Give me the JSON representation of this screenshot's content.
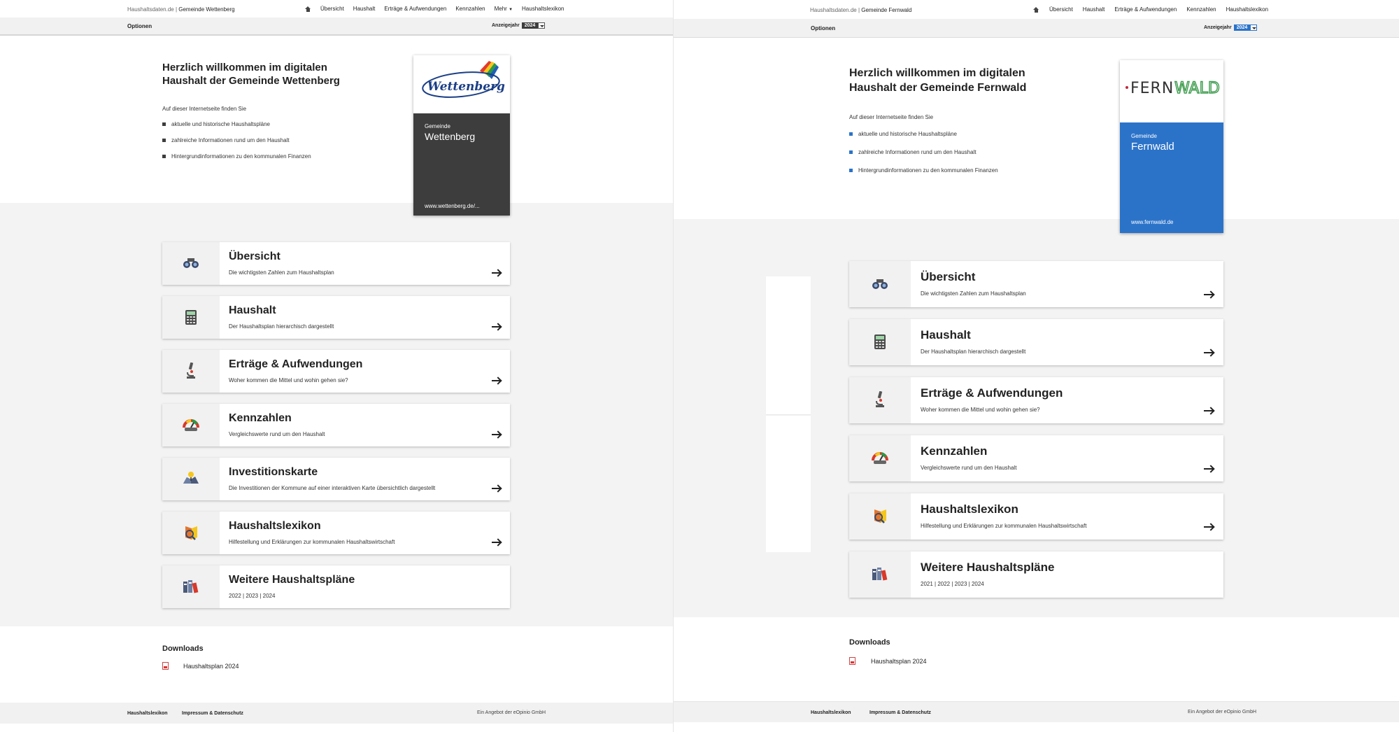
{
  "left": {
    "brand": {
      "site": "Haushaltsdaten.de |",
      "municipality": "Gemeinde Wettenberg"
    },
    "nav": [
      "Übersicht",
      "Haushalt",
      "Erträge & Aufwendungen",
      "Kennzahlen",
      "Mehr",
      "Haushaltslexikon"
    ],
    "options_label": "Optionen",
    "year_label": "Anzeigejahr",
    "year_value": "2024",
    "accent": "#3d3d3d",
    "hero_title_1": "Herzlich willkommen im digitalen",
    "hero_title_2": "Haushalt der Gemeinde Wettenberg",
    "intro": "Auf dieser Internetseite finden Sie",
    "bullets": [
      "aktuelle und historische Haushaltspläne",
      "zahlreiche Informationen rund um den Haushalt",
      "Hintergrundinformationen zu den kommunalen Finanzen"
    ],
    "card": {
      "logo_text": "Wettenberg",
      "small": "Gemeinde",
      "name": "Wettenberg",
      "url": "www.wettenberg.de/..."
    },
    "tiles": [
      {
        "title": "Übersicht",
        "sub": "Die wichtigsten Zahlen zum Haushaltsplan",
        "icon": "binoculars-icon"
      },
      {
        "title": "Haushalt",
        "sub": "Der Haushaltsplan hierarchisch dargestellt",
        "icon": "calculator-icon"
      },
      {
        "title": "Erträge & Aufwendungen",
        "sub": "Woher kommen die Mittel und wohin gehen sie?",
        "icon": "microscope-icon"
      },
      {
        "title": "Kennzahlen",
        "sub": "Vergleichswerte rund um den Haushalt",
        "icon": "gauge-icon"
      },
      {
        "title": "Investitionskarte",
        "sub": "Die Investitionen der Kommune auf einer interaktiven Karte übersichtlich dargestellt",
        "icon": "map-pin-icon"
      },
      {
        "title": "Haushaltslexikon",
        "sub": "Hilfestellung und Erklärungen zur kommunalen Haushaltswirtschaft",
        "icon": "book-icon"
      },
      {
        "title": "Weitere Haushaltspläne",
        "sub": "2022 | 2023 | 2024",
        "icon": "folders-icon"
      }
    ],
    "downloads_title": "Downloads",
    "download_item": "Haushaltsplan 2024",
    "footer": {
      "link1": "Haushaltslexikon",
      "link2": "Impressum & Datenschutz",
      "credit": "Ein Angebot der eOpinio GmbH"
    }
  },
  "right": {
    "brand": {
      "site": "Haushaltsdaten.de |",
      "municipality": "Gemeinde Fernwald"
    },
    "nav": [
      "Übersicht",
      "Haushalt",
      "Erträge & Aufwendungen",
      "Kennzahlen",
      "Haushaltslexikon"
    ],
    "options_label": "Optionen",
    "year_label": "Anzeigejahr",
    "year_value": "2024",
    "accent": "#2b73c9",
    "hero_title_1": "Herzlich willkommen im digitalen",
    "hero_title_2": "Haushalt der Gemeinde Fernwald",
    "intro": "Auf dieser Internetseite finden Sie",
    "bullets": [
      "aktuelle und historische Haushaltspläne",
      "zahlreiche Informationen rund um den Haushalt",
      "Hintergrundinformationen zu den kommunalen Finanzen"
    ],
    "card": {
      "logo_text_1": "FERN",
      "logo_text_2": "WALD",
      "small": "Gemeinde",
      "name": "Fernwald",
      "url": "www.fernwald.de"
    },
    "tiles": [
      {
        "title": "Übersicht",
        "sub": "Die wichtigsten Zahlen zum Haushaltsplan",
        "icon": "binoculars-icon"
      },
      {
        "title": "Haushalt",
        "sub": "Der Haushaltsplan hierarchisch dargestellt",
        "icon": "calculator-icon"
      },
      {
        "title": "Erträge & Aufwendungen",
        "sub": "Woher kommen die Mittel und wohin gehen sie?",
        "icon": "microscope-icon"
      },
      {
        "title": "Kennzahlen",
        "sub": "Vergleichswerte rund um den Haushalt",
        "icon": "gauge-icon"
      },
      {
        "title": "Haushaltslexikon",
        "sub": "Hilfestellung und Erklärungen zur kommunalen Haushaltswirtschaft",
        "icon": "book-icon"
      },
      {
        "title": "Weitere Haushaltspläne",
        "sub": "2021 | 2022 | 2023 | 2024",
        "icon": "folders-icon"
      }
    ],
    "downloads_title": "Downloads",
    "download_item": "Haushaltsplan 2024",
    "footer": {
      "link1": "Haushaltslexikon",
      "link2": "Impressum & Datenschutz",
      "credit": "Ein Angebot der eOpinio GmbH"
    }
  }
}
